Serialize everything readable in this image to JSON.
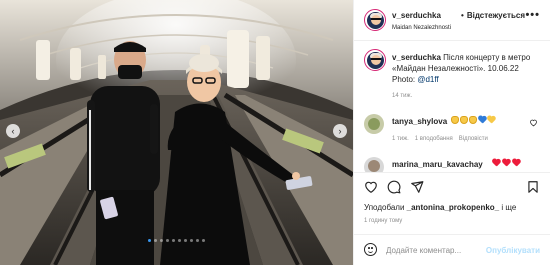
{
  "header": {
    "username": "v_serduchka",
    "separator": "•",
    "follow_status": "Відстежується",
    "location": "Maidan Nezalezhnosti",
    "more_glyph": "•••"
  },
  "caption": {
    "username": "v_serduchka",
    "text": "Після концерту в метро «Майдан Незалежності». 10.06.22 Photo: ",
    "mention": "@d1ff",
    "time": "14 тиж."
  },
  "comments": [
    {
      "username": "tanya_shylova",
      "emojis": [
        "hand",
        "hand",
        "hand",
        "blue-heart",
        "yellow-heart"
      ],
      "time": "1 тиж.",
      "likes": "1 вподобання",
      "reply": "Відповісти"
    },
    {
      "username": "marina_maru_kavachay",
      "emojis": [
        "red-heart",
        "red-heart",
        "red-heart"
      ]
    }
  ],
  "likes_text": {
    "prefix": "Уподобали ",
    "user": "_antonina_prokopenko_",
    "suffix": " і ще"
  },
  "post_time": "1 годину тому",
  "comment_box": {
    "placeholder": "Додайте коментар...",
    "publish": "Опублікувати"
  },
  "carousel": {
    "slides": 10,
    "active_index": 0
  },
  "colors": {
    "link": "#00376b",
    "publish_disabled": "#b2dffc",
    "active_dot": "#3897f0",
    "heart_red": "#ed1c3b"
  }
}
